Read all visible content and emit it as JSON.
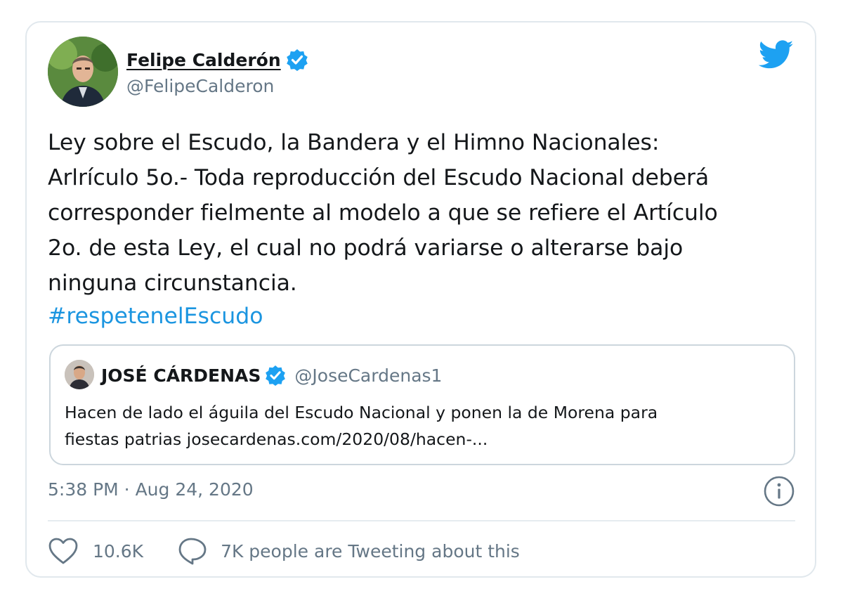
{
  "author": {
    "display_name": "Felipe Calderón",
    "handle": "@FelipeCalderon",
    "verified": true
  },
  "tweet": {
    "text": "Ley sobre el Escudo, la Bandera y el Himno Nacionales:\nArlrículo 5o.- Toda reproducción del Escudo Nacional deberá\ncorresponder fielmente al modelo a que se refiere el Artículo\n2o. de esta Ley, el cual no podrá variarse o alterarse bajo\nninguna circunstancia.",
    "hashtag": "#respetenelEscudo"
  },
  "quoted_tweet": {
    "display_name": "JOSÉ CÁRDENAS",
    "handle": "@JoseCardenas1",
    "verified": true,
    "text": "Hacen de lado el águila del Escudo Nacional y ponen la de Morena para\nfiestas patrias josecardenas.com/2020/08/hacen-..."
  },
  "meta": {
    "timestamp": "5:38 PM · Aug 24, 2020"
  },
  "actions": {
    "like_count": "10.6K",
    "reply_text": "7K people are Tweeting about this"
  },
  "icons": {
    "brand": "twitter-bird-icon",
    "verified": "verified-badge-icon",
    "info": "info-icon",
    "like": "heart-icon",
    "reply": "speech-bubble-icon"
  },
  "colors": {
    "brand_blue": "#1da1f2",
    "link_blue": "#1b95e0",
    "text_primary": "#14171a",
    "text_secondary": "#657786",
    "border": "#e1e8ed"
  }
}
